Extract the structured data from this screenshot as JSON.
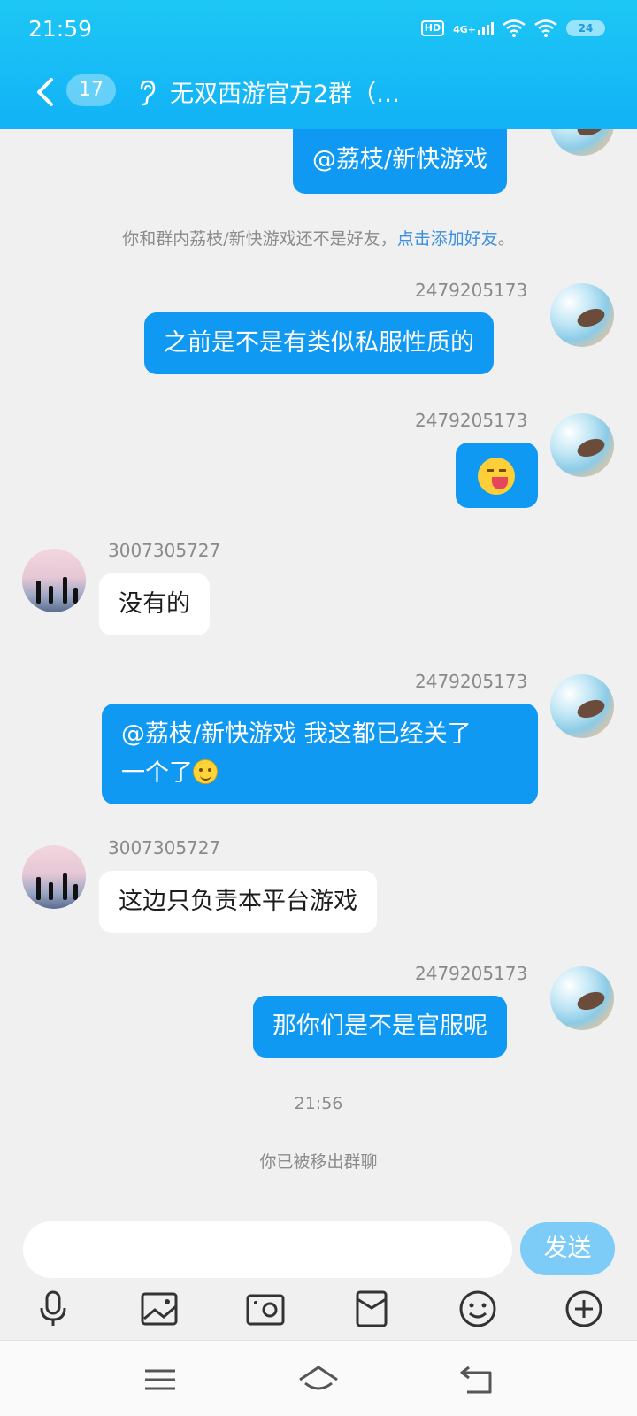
{
  "status_bar": {
    "time": "21:59",
    "hd_label": "HD",
    "network_label": "4G+",
    "battery": "24"
  },
  "title_bar": {
    "unread_count": "17",
    "group_title": "无双西游官方2群（…"
  },
  "messages": [
    {
      "side": "out",
      "text": "@荔枝/新快游戏"
    },
    {
      "side": "system",
      "text": "你和群内荔枝/新快游戏还不是好友，",
      "link": "点击添加好友",
      "suffix": "。"
    },
    {
      "side": "out",
      "sender": "2479205173",
      "text": "之前是不是有类似私服性质的"
    },
    {
      "side": "out",
      "sender": "2479205173",
      "sticker": "drooling-sticker"
    },
    {
      "side": "in",
      "sender": "3007305727",
      "text": "没有的"
    },
    {
      "side": "out",
      "sender": "2479205173",
      "text_line1": "@荔枝/新快游戏 我这都已经关了",
      "text_line2": "一个了",
      "emoji": "smile-emoji"
    },
    {
      "side": "in",
      "sender": "3007305727",
      "text": "这边只负责本平台游戏"
    },
    {
      "side": "out",
      "sender": "2479205173",
      "text": "那你们是不是官服呢"
    },
    {
      "side": "time",
      "text": "21:56"
    },
    {
      "side": "system",
      "text": "你已被移出群聊"
    }
  ],
  "input": {
    "placeholder": "",
    "send_label": "发送"
  },
  "toolbar": [
    "mic-icon",
    "image-icon",
    "camera-icon",
    "red-packet-icon",
    "emoji-icon",
    "plus-icon"
  ],
  "nav": [
    "menu-icon",
    "home-icon",
    "back-nav-icon"
  ],
  "colors": {
    "header": "#12b2f6",
    "outgoing_bubble": "#0f99f3",
    "incoming_bubble": "#ffffff",
    "send_button": "#7dcbf7",
    "link": "#3b8fe0"
  }
}
